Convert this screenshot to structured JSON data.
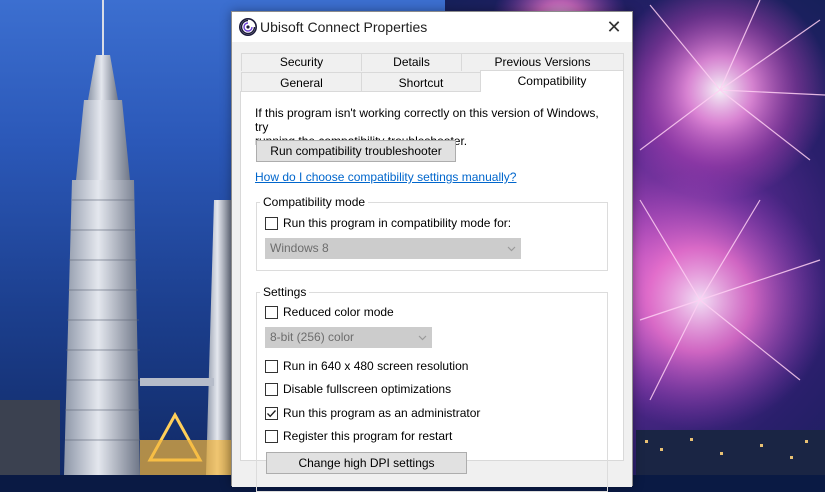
{
  "window": {
    "title": "Ubisoft Connect Properties",
    "close_glyph": "✕"
  },
  "tabs": {
    "row1": [
      {
        "label": "Security"
      },
      {
        "label": "Details"
      },
      {
        "label": "Previous Versions"
      }
    ],
    "row2": [
      {
        "label": "General"
      },
      {
        "label": "Shortcut"
      },
      {
        "label": "Compatibility",
        "active": true
      }
    ]
  },
  "compatibility": {
    "intro_line1": "If this program isn't working correctly on this version of Windows, try",
    "intro_line2": "running the compatibility troubleshooter.",
    "troubleshooter_button": "Run compatibility troubleshooter",
    "help_link": "How do I choose compatibility settings manually?",
    "mode_group": {
      "title": "Compatibility mode",
      "checkbox_label": "Run this program in compatibility mode for:",
      "checked": false,
      "os_select_value": "Windows 8"
    },
    "settings_group": {
      "title": "Settings",
      "reduced_color": {
        "label": "Reduced color mode",
        "checked": false
      },
      "color_select_value": "8-bit (256) color",
      "res_640": {
        "label": "Run in 640 x 480 screen resolution",
        "checked": false
      },
      "disable_fullscreen": {
        "label": "Disable fullscreen optimizations",
        "checked": false
      },
      "run_as_admin": {
        "label": "Run this program as an administrator",
        "checked": true
      },
      "register_restart": {
        "label": "Register this program for restart",
        "checked": false
      },
      "dpi_button": "Change high DPI settings"
    }
  },
  "colors": {
    "link": "#0066cc",
    "dialog_bg": "#f0f0f0",
    "panel_bg": "#ffffff"
  },
  "icons": {
    "app": "ubisoft-swirl-icon",
    "close": "close-icon",
    "dropdown": "chevron-down-icon",
    "check": "checkmark-icon"
  }
}
